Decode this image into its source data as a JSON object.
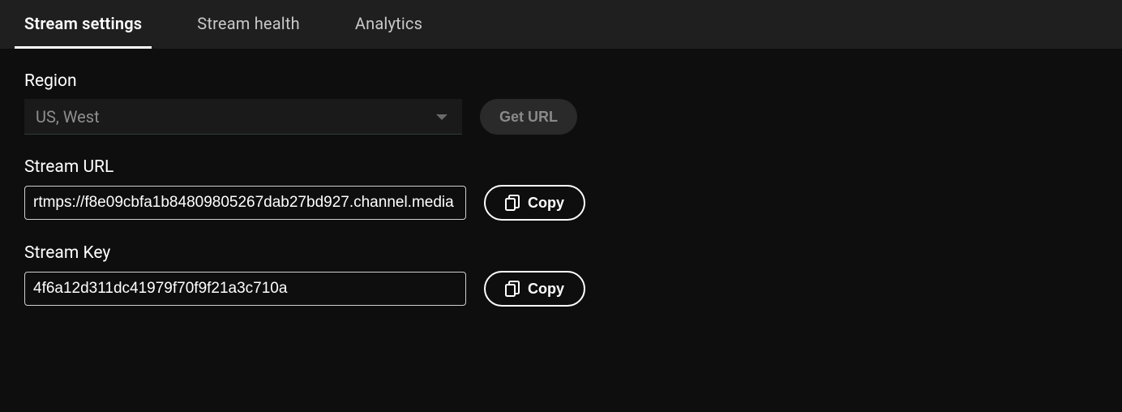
{
  "tabs": {
    "stream_settings": "Stream settings",
    "stream_health": "Stream health",
    "analytics": "Analytics"
  },
  "region": {
    "label": "Region",
    "selected": "US, West",
    "get_url_label": "Get URL"
  },
  "stream_url": {
    "label": "Stream URL",
    "value": "rtmps://f8e09cbfa1b84809805267dab27bd927.channel.media",
    "copy_label": "Copy"
  },
  "stream_key": {
    "label": "Stream Key",
    "value": "4f6a12d311dc41979f70f9f21a3c710a",
    "copy_label": "Copy"
  }
}
